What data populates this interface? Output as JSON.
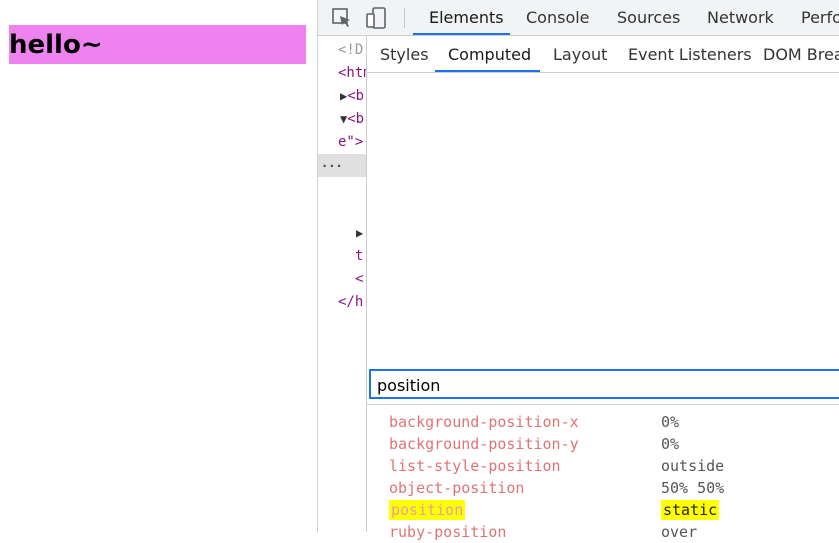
{
  "page": {
    "heading": "hello~",
    "box_color": "#ee82ee"
  },
  "toolbar": {
    "inspect_icon": "inspect-element-icon",
    "device_icon": "device-toolbar-icon",
    "tabs": [
      "Elements",
      "Console",
      "Sources",
      "Network",
      "Perfo"
    ]
  },
  "dom": {
    "lines": [
      "<!D",
      "<htm",
      "<b",
      "<b",
      "e\">",
      "...",
      "t",
      "<",
      "</h"
    ]
  },
  "sidebar": {
    "tabs": [
      "Styles",
      "Computed",
      "Layout",
      "Event Listeners",
      "DOM Brea"
    ],
    "filter_value": "position",
    "properties": [
      {
        "name": "background-position-x",
        "value": "0%"
      },
      {
        "name": "background-position-y",
        "value": "0%"
      },
      {
        "name": "list-style-position",
        "value": "outside"
      },
      {
        "name": "object-position",
        "value": "50% 50%"
      },
      {
        "name": "position",
        "value": "static"
      },
      {
        "name": "ruby-position",
        "value": "over"
      }
    ]
  },
  "colors": {
    "accent": "#1a73e8",
    "highlight": "#ffff00"
  }
}
